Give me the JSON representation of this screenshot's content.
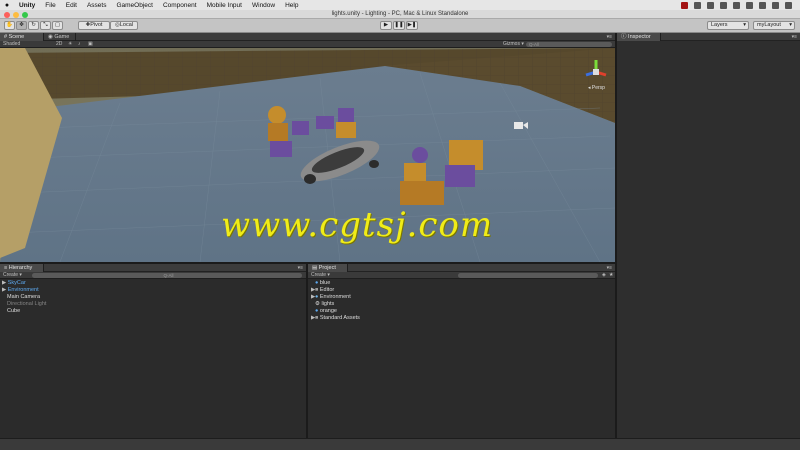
{
  "menubar": {
    "app_name": "Unity",
    "items": [
      "File",
      "Edit",
      "Assets",
      "GameObject",
      "Component",
      "Mobile Input",
      "Window",
      "Help"
    ]
  },
  "window_title": "lights.unity - Lighting - PC, Mac & Linux Standalone",
  "toolbar": {
    "pivot": "Pivot",
    "local": "Local",
    "layers": "Layers",
    "layout": "myLayout",
    "play_glyph": "▶",
    "pause_glyph": "❚❚",
    "step_glyph": "▶❚"
  },
  "scene_view": {
    "tabs": [
      "Scene",
      "Game"
    ],
    "shading_mode": "Shaded",
    "mode_2d": "2D",
    "gizmos_label": "Gizmos ▾",
    "search_placeholder": "Q-All",
    "persp_label": "◂ Persp"
  },
  "inspector": {
    "tab": "Inspector"
  },
  "hierarchy": {
    "tab": "Hierarchy",
    "create_label": "Create ▾",
    "search_placeholder": "Q-All",
    "items": [
      {
        "name": "SkyCar",
        "indent": 0,
        "arrow": "▶",
        "style": "blue"
      },
      {
        "name": "Environment",
        "indent": 0,
        "arrow": "▶",
        "style": "blue"
      },
      {
        "name": "Main Camera",
        "indent": 1,
        "arrow": "",
        "style": "light"
      },
      {
        "name": "Directional Light",
        "indent": 1,
        "arrow": "",
        "style": "dim"
      },
      {
        "name": "Cube",
        "indent": 1,
        "arrow": "",
        "style": "light"
      }
    ]
  },
  "project": {
    "tab": "Project",
    "create_label": "Create ▾",
    "items": [
      {
        "name": "blue",
        "type": "material",
        "arrow": ""
      },
      {
        "name": "Editor",
        "type": "folder",
        "arrow": "▶"
      },
      {
        "name": "Environment",
        "type": "scene",
        "arrow": "▶"
      },
      {
        "name": "lights",
        "type": "unity-scene",
        "arrow": ""
      },
      {
        "name": "orange",
        "type": "material",
        "arrow": ""
      },
      {
        "name": "Standard Assets",
        "type": "folder",
        "arrow": "▶"
      }
    ]
  },
  "watermark": "www.cgtsj.com",
  "colors": {
    "accent_blue": "#5da9f0",
    "watermark_yellow": "#f0ec18",
    "floor": "#6a7f92",
    "walls": "#56482c"
  }
}
